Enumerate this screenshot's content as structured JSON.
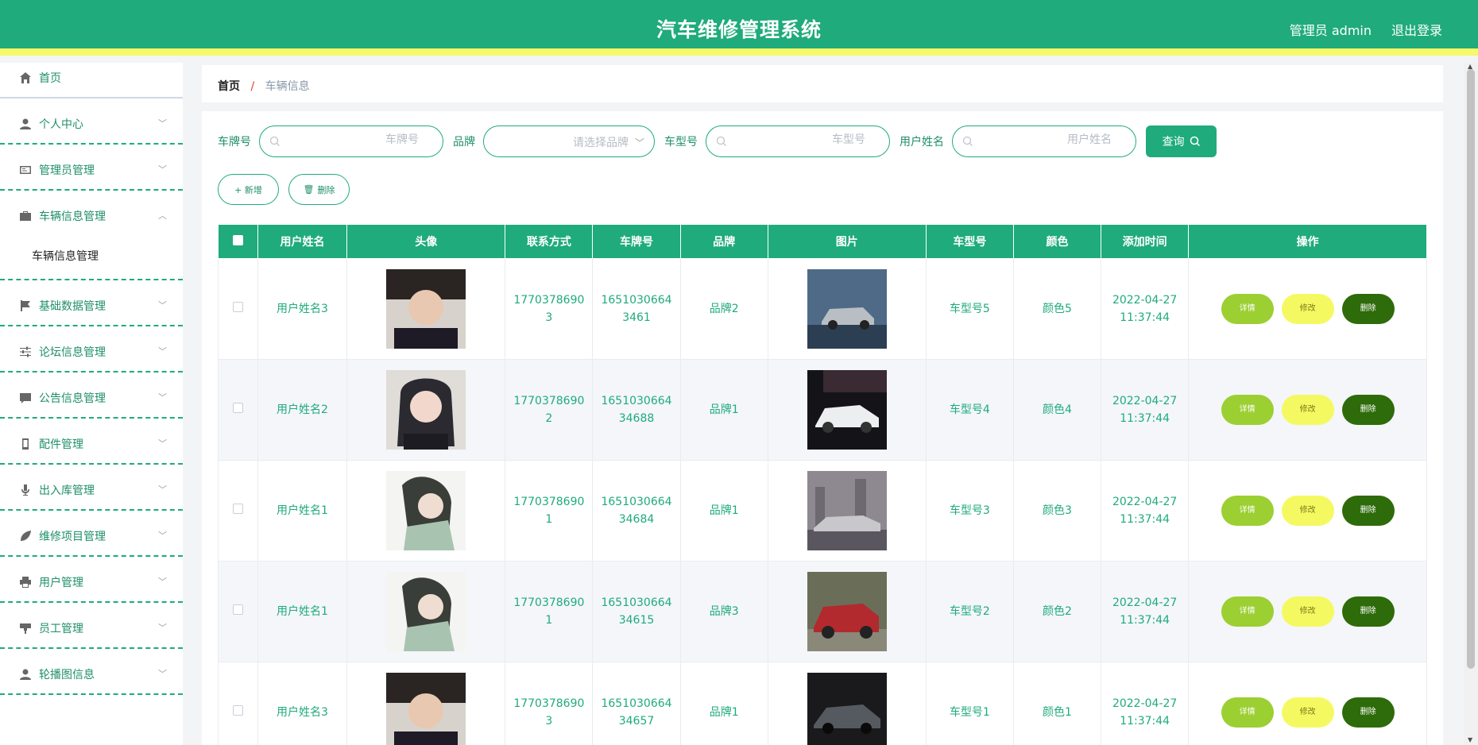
{
  "header": {
    "title": "汽车维修管理系统",
    "user": "管理员 admin",
    "logout": "退出登录"
  },
  "sidebar": {
    "items": [
      {
        "label": "首页",
        "icon": "home-icon"
      },
      {
        "label": "个人中心",
        "icon": "person-icon"
      },
      {
        "label": "管理员管理",
        "icon": "id-card-icon"
      },
      {
        "label": "车辆信息管理",
        "icon": "briefcase-icon",
        "sub": "车辆信息管理"
      },
      {
        "label": "基础数据管理",
        "icon": "flag-icon"
      },
      {
        "label": "论坛信息管理",
        "icon": "sliders-icon"
      },
      {
        "label": "公告信息管理",
        "icon": "chat-icon"
      },
      {
        "label": "配件管理",
        "icon": "phone-icon"
      },
      {
        "label": "出入库管理",
        "icon": "microphone-icon"
      },
      {
        "label": "维修项目管理",
        "icon": "leaf-icon"
      },
      {
        "label": "用户管理",
        "icon": "printer-icon"
      },
      {
        "label": "员工管理",
        "icon": "tool-icon"
      },
      {
        "label": "轮播图信息",
        "icon": "person-icon"
      }
    ]
  },
  "breadcrumb": {
    "home": "首页",
    "sep": "/",
    "current": "车辆信息"
  },
  "search": {
    "plate_label": "车牌号",
    "plate_placeholder": "车牌号",
    "brand_label": "品牌",
    "brand_placeholder": "请选择品牌",
    "model_label": "车型号",
    "model_placeholder": "车型号",
    "user_label": "用户姓名",
    "user_placeholder": "用户姓名",
    "search_button": "查询"
  },
  "actions": {
    "add": "+ 新增",
    "delete": "删除"
  },
  "table": {
    "headers": [
      "用户姓名",
      "头像",
      "联系方式",
      "车牌号",
      "品牌",
      "图片",
      "车型号",
      "颜色",
      "添加时间",
      "操作"
    ],
    "ops": {
      "detail": "详情",
      "edit": "修改",
      "delete": "删除"
    },
    "rows": [
      {
        "user": "用户姓名3",
        "phone1": "1770378690",
        "phone2": "3",
        "plate1": "1651030664",
        "plate2": "3461",
        "brand": "品牌2",
        "model": "车型号5",
        "color": "颜色5",
        "date": "2022-04-27",
        "time": "11:37:44"
      },
      {
        "user": "用户姓名2",
        "phone1": "1770378690",
        "phone2": "2",
        "plate1": "1651030664",
        "plate2": "34688",
        "brand": "品牌1",
        "model": "车型号4",
        "color": "颜色4",
        "date": "2022-04-27",
        "time": "11:37:44"
      },
      {
        "user": "用户姓名1",
        "phone1": "1770378690",
        "phone2": "1",
        "plate1": "1651030664",
        "plate2": "34684",
        "brand": "品牌1",
        "model": "车型号3",
        "color": "颜色3",
        "date": "2022-04-27",
        "time": "11:37:44"
      },
      {
        "user": "用户姓名1",
        "phone1": "1770378690",
        "phone2": "1",
        "plate1": "1651030664",
        "plate2": "34615",
        "brand": "品牌3",
        "model": "车型号2",
        "color": "颜色2",
        "date": "2022-04-27",
        "time": "11:37:44"
      },
      {
        "user": "用户姓名3",
        "phone1": "1770378690",
        "phone2": "3",
        "plate1": "1651030664",
        "plate2": "34657",
        "brand": "品牌1",
        "model": "车型号1",
        "color": "颜色1",
        "date": "2022-04-27",
        "time": "11:37:44"
      }
    ]
  },
  "colors": {
    "primary": "#1fab7b",
    "accent_bar": "#f5f96a",
    "detail": "#9ccf32",
    "edit": "#f5f961",
    "delete": "#2e6b0a"
  }
}
